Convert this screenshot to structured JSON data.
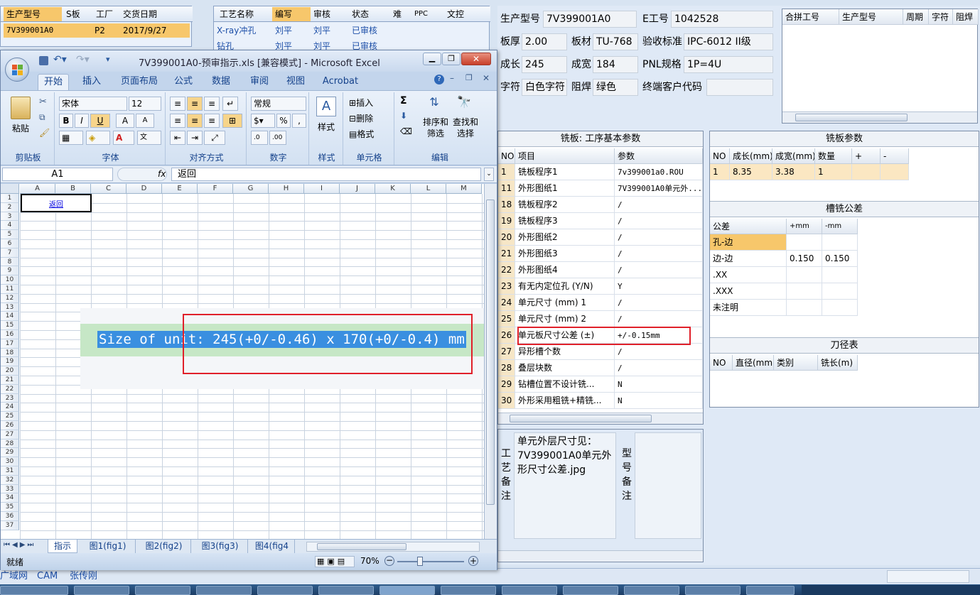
{
  "left_grid": {
    "headers": [
      "生产型号",
      "S板",
      "工厂",
      "交货日期"
    ],
    "row": [
      "7V399001A0",
      "",
      "P2",
      "2017/9/27"
    ]
  },
  "mid_grid": {
    "headers": [
      "工艺名称",
      "编写",
      "审核",
      "状态",
      "难",
      "PPC",
      "文控"
    ],
    "rows": [
      [
        "X-ray冲孔",
        "刘平",
        "刘平",
        "已审核"
      ],
      [
        "钻孔",
        "刘平",
        "刘平",
        "已审核"
      ]
    ]
  },
  "info": {
    "model_label": "生产型号",
    "model_value": "7V399001A0",
    "eno_label": "E工号",
    "eno_value": "1042528",
    "thick_label": "板厚",
    "thick_value": "2.00",
    "mat_label": "板材",
    "mat_value": "TU-768",
    "std_label": "验收标准",
    "std_value": "IPC-6012 II级",
    "len_label": "成长",
    "len_value": "245",
    "wid_label": "成宽",
    "wid_value": "184",
    "pnl_label": "PNL规格",
    "pnl_value": "1P=4U",
    "char_label": "字符",
    "char_value": "白色字符",
    "mask_label": "阻焊",
    "mask_value": "绿色",
    "cust_label": "终端客户代码",
    "cust_value": ""
  },
  "merge_grid": {
    "headers": [
      "合拼工号",
      "生产型号",
      "周期",
      "字符",
      "阻焊"
    ]
  },
  "mill_params": {
    "title": "铣板: 工序基本参数",
    "headers": [
      "NO",
      "项目",
      "参数"
    ],
    "rows": [
      [
        "1",
        "铣板程序1",
        "7v399001a0.ROU"
      ],
      [
        "11",
        "外形图纸1",
        "7V399001A0单元外..."
      ],
      [
        "18",
        "铣板程序2",
        "/"
      ],
      [
        "19",
        "铣板程序3",
        "/"
      ],
      [
        "20",
        "外形图纸2",
        "/"
      ],
      [
        "21",
        "外形图纸3",
        "/"
      ],
      [
        "22",
        "外形图纸4",
        "/"
      ],
      [
        "23",
        "有无内定位孔 (Y/N)",
        "Y"
      ],
      [
        "24",
        "单元尺寸 (mm) 1",
        "/"
      ],
      [
        "25",
        "单元尺寸 (mm) 2",
        "/"
      ],
      [
        "26",
        "单元板尺寸公差 (±)",
        "+/-0.15mm"
      ],
      [
        "27",
        "异形槽个数",
        "/"
      ],
      [
        "28",
        "叠层块数",
        "/"
      ],
      [
        "29",
        "钻槽位置不设计铣...",
        "N"
      ],
      [
        "30",
        "外形采用粗铣+精铣...",
        "N"
      ]
    ]
  },
  "board_params": {
    "title": "铣板参数",
    "headers": [
      "NO",
      "成长(mm)",
      "成宽(mm)",
      "数量",
      "+",
      "-"
    ],
    "row": [
      "1",
      "8.35",
      "3.38",
      "1",
      "",
      ""
    ]
  },
  "slot_tol": {
    "title": "槽铣公差",
    "headers": [
      "公差",
      "+mm",
      "-mm"
    ],
    "rows": [
      [
        "孔-边",
        "",
        ""
      ],
      [
        "边-边",
        "0.150",
        "0.150"
      ],
      [
        ".XX",
        "",
        ""
      ],
      [
        ".XXX",
        "",
        ""
      ],
      [
        "未注明",
        "",
        ""
      ]
    ]
  },
  "tool_dia": {
    "title": "刀径表",
    "headers": [
      "NO",
      "直径(mm)",
      "类别",
      "铣长(m)"
    ]
  },
  "remarks": {
    "process_label": "工艺备注",
    "process_text": "单元外层尺寸见：7V399001A0单元外形尺寸公差.jpg",
    "model_label": "型号备注"
  },
  "bottom_tabs": [
    "广域网",
    "CAM",
    "张传刚"
  ],
  "excel": {
    "title": "7V399001A0-预审指示.xls [兼容模式] - Microsoft Excel",
    "tabs": [
      "开始",
      "插入",
      "页面布局",
      "公式",
      "数据",
      "审阅",
      "视图",
      "Acrobat"
    ],
    "font_name": "宋体",
    "font_size": "12",
    "number_format": "常规",
    "groups": [
      "剪贴板",
      "字体",
      "对齐方式",
      "数字",
      "样式",
      "单元格",
      "编辑"
    ],
    "paste_label": "粘贴",
    "style_label": "样式",
    "insert_label": "插入",
    "delete_label": "删除",
    "format_label": "格式",
    "sort_label": "排序和筛选",
    "find_label": "查找和选择",
    "name_box": "A1",
    "fx": "fx",
    "formula": "返回",
    "cols": [
      "A",
      "B",
      "C",
      "D",
      "E",
      "F",
      "G",
      "H",
      "I",
      "J",
      "K",
      "L",
      "M"
    ],
    "cell_link": "返回",
    "unit_text": "Size of unit: 245(+0/-0.46) x 170(+0/-0.4) mm",
    "sheets": [
      "指示",
      "图1(fig1)",
      "图2(fig2)",
      "图3(fig3)",
      "图4(fig4"
    ],
    "status": "就绪",
    "zoom": "70%"
  }
}
